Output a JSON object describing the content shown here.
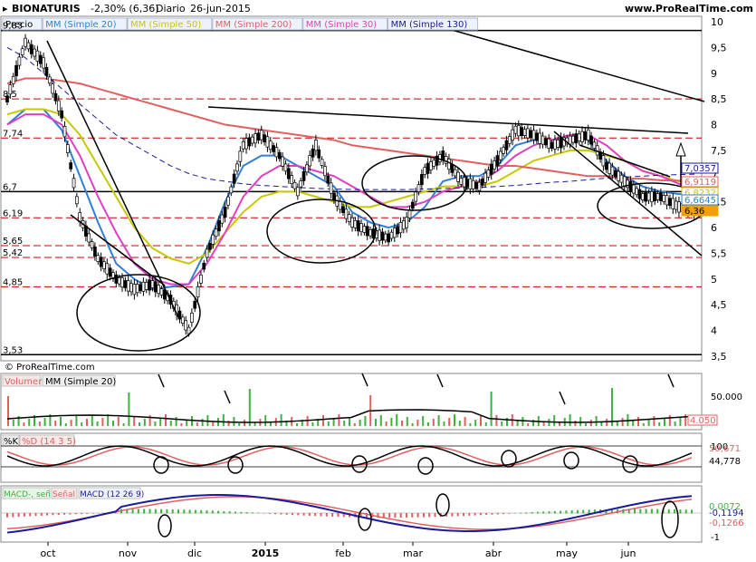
{
  "header": {
    "symbol": "BIONATURIS",
    "change": "-2,30% (6,36)",
    "period": "Diario",
    "date": "26-jun-2015",
    "site": "www.ProRealTime.com"
  },
  "copyright": "© ProRealTime.com",
  "x_months": [
    "oct",
    "nov",
    "dic",
    "2015",
    "feb",
    "mar",
    "abr",
    "may",
    "jun"
  ],
  "price_panel": {
    "legend": [
      "Precio",
      "MM (Simple 20)",
      "MM (Simple 50)",
      "MM (Simple 200)",
      "MM (Simple 30)",
      "MM (Simple 130)"
    ],
    "legend_colors": [
      "#000000",
      "#2f7fd6",
      "#c8c800",
      "#e06060",
      "#e040c0",
      "#1a1a9a"
    ],
    "right_ticks": [
      "10",
      "9,5",
      "9",
      "8,5",
      "8",
      "7,5",
      "7",
      "6,5",
      "6",
      "5,5",
      "5",
      "4,5",
      "4",
      "3,5"
    ],
    "left_levels": [
      "9,83",
      "8,5",
      "7,74",
      "6,7",
      "6,19",
      "5,65",
      "5,42",
      "4,85",
      "3,53"
    ],
    "value_tags": [
      {
        "text": "7,0357",
        "color": "#1a1a9a"
      },
      {
        "text": "6,9119",
        "color": "#e06060"
      },
      {
        "text": "6,8232",
        "color": "#c8c800"
      },
      {
        "text": "6,6645",
        "color": "#2f7fd6"
      },
      {
        "text": "6,36",
        "color": "#f0a000"
      }
    ]
  },
  "volume_panel": {
    "legend": [
      "Volumen",
      "MM (Simple 20)"
    ],
    "right_tick": "50.000",
    "value_tag": "4.050"
  },
  "stoch_panel": {
    "legend": [
      "%K",
      "%D (14 3 5)"
    ],
    "right_tick": "100",
    "value_tags": [
      "50,671",
      "44,778"
    ]
  },
  "macd_panel": {
    "legend": [
      "MACD-, señal",
      "Señal",
      "MACD (12 26 9)"
    ],
    "right_tick": "-1",
    "value_tags": [
      "0,0072",
      "-0,1194",
      "-0,1266"
    ]
  },
  "chart_data": {
    "type": "candlestick",
    "title": "BIONATURIS",
    "series": [
      {
        "name": "Precio",
        "values": [
          8.5,
          9.6,
          9.2,
          8.2,
          6.2,
          5.4,
          5.0,
          4.8,
          4.9,
          4.6,
          4.0,
          5.5,
          6.3,
          7.6,
          7.8,
          7.4,
          6.7,
          7.6,
          6.6,
          6.1,
          5.9,
          5.8,
          6.1,
          7.1,
          7.4,
          6.9,
          6.8,
          7.3,
          7.9,
          7.8,
          7.6,
          7.7,
          7.8,
          7.2,
          6.9,
          6.6,
          6.6,
          6.4,
          6.36
        ]
      },
      {
        "name": "MM (Simple 20)",
        "values": [
          8.0,
          8.3,
          8.3,
          7.9,
          7.0,
          6.1,
          5.3,
          5.0,
          4.8,
          4.85,
          4.9,
          5.6,
          6.5,
          7.2,
          7.4,
          7.4,
          7.2,
          7.0,
          6.8,
          6.3,
          6.1,
          6.0,
          6.1,
          6.4,
          6.9,
          7.0,
          7.0,
          7.2,
          7.6,
          7.7,
          7.7,
          7.8,
          7.7,
          7.3,
          7.0,
          6.8,
          6.7,
          6.65,
          6.66
        ]
      },
      {
        "name": "MM (Simple 50)",
        "values": [
          8.2,
          8.3,
          8.3,
          8.2,
          7.8,
          7.2,
          6.6,
          6.0,
          5.6,
          5.4,
          5.3,
          5.5,
          5.9,
          6.3,
          6.6,
          6.7,
          6.7,
          6.6,
          6.5,
          6.4,
          6.4,
          6.5,
          6.6,
          6.7,
          6.8,
          6.8,
          6.8,
          6.9,
          7.1,
          7.3,
          7.4,
          7.5,
          7.5,
          7.4,
          7.3,
          7.1,
          7.0,
          6.9,
          6.82
        ]
      },
      {
        "name": "MM (Simple 200)",
        "values": [
          8.8,
          8.9,
          8.9,
          8.85,
          8.8,
          8.7,
          8.6,
          8.5,
          8.4,
          8.3,
          8.2,
          8.1,
          8.0,
          7.95,
          7.9,
          7.85,
          7.8,
          7.75,
          7.7,
          7.6,
          7.55,
          7.5,
          7.45,
          7.4,
          7.35,
          7.3,
          7.25,
          7.2,
          7.2,
          7.15,
          7.1,
          7.05,
          7.0,
          7.0,
          6.95,
          6.95,
          6.92,
          6.91,
          6.91
        ]
      },
      {
        "name": "MM (Simple 30)",
        "values": [
          8.0,
          8.2,
          8.2,
          8.0,
          7.4,
          6.6,
          5.9,
          5.3,
          5.0,
          4.9,
          4.9,
          5.3,
          5.9,
          6.6,
          7.0,
          7.2,
          7.2,
          7.1,
          7.0,
          6.8,
          6.6,
          6.4,
          6.4,
          6.5,
          6.7,
          6.8,
          6.9,
          7.1,
          7.4,
          7.6,
          7.7,
          7.8,
          7.8,
          7.6,
          7.3,
          7.1,
          7.0,
          6.85,
          6.8
        ]
      },
      {
        "name": "MM (Simple 130)",
        "values": [
          9.5,
          9.3,
          9.0,
          8.7,
          8.4,
          8.1,
          7.8,
          7.6,
          7.4,
          7.2,
          7.05,
          6.95,
          6.9,
          6.85,
          6.82,
          6.8,
          6.78,
          6.76,
          6.75,
          6.74,
          6.74,
          6.74,
          6.74,
          6.75,
          6.76,
          6.77,
          6.78,
          6.8,
          6.82,
          6.85,
          6.88,
          6.9,
          6.93,
          6.96,
          6.98,
          7.0,
          7.02,
          7.03,
          7.04
        ]
      }
    ],
    "ylim": [
      3.5,
      10
    ],
    "grid": false
  }
}
